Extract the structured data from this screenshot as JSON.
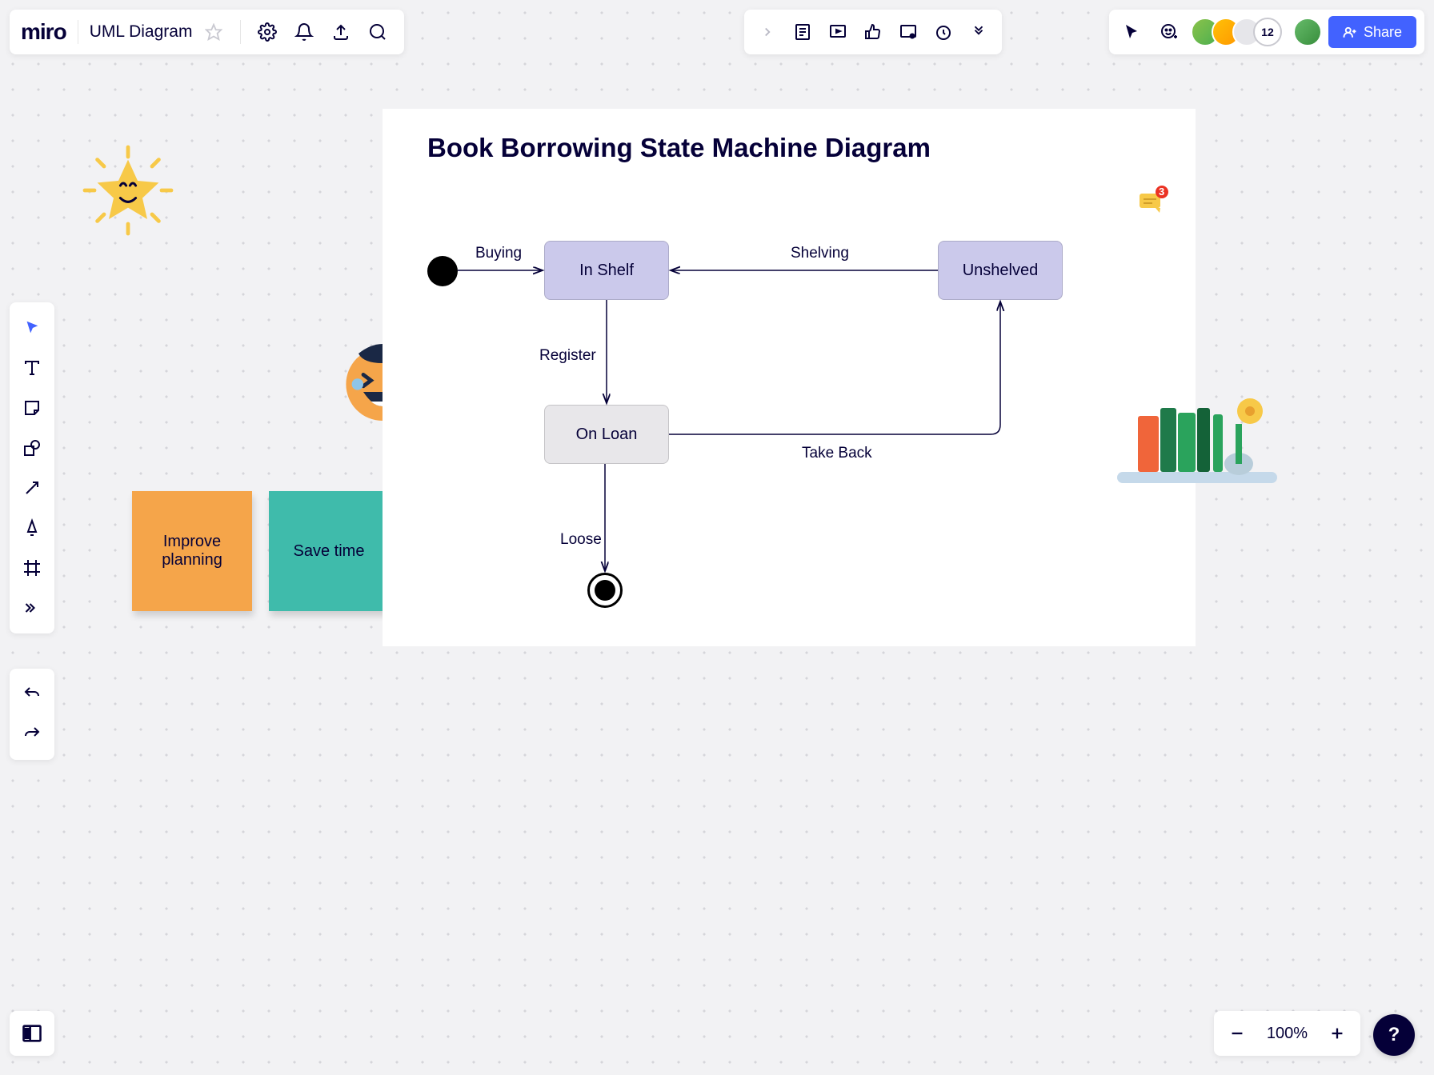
{
  "header": {
    "logo": "miro",
    "title": "UML Diagram",
    "share_label": "Share",
    "user_count": "12"
  },
  "diagram": {
    "title": "Book Borrowing State Machine Diagram",
    "nodes": {
      "in_shelf": "In Shelf",
      "unshelved": "Unshelved",
      "on_loan": "On Loan"
    },
    "transitions": {
      "buying": "Buying",
      "shelving": "Shelving",
      "register": "Register",
      "take_back": "Take Back",
      "loose": "Loose"
    }
  },
  "stickies": {
    "orange": "Improve planning",
    "teal": "Save time"
  },
  "zoom": {
    "percent": "100%"
  },
  "help": "?",
  "badge_count": "3"
}
